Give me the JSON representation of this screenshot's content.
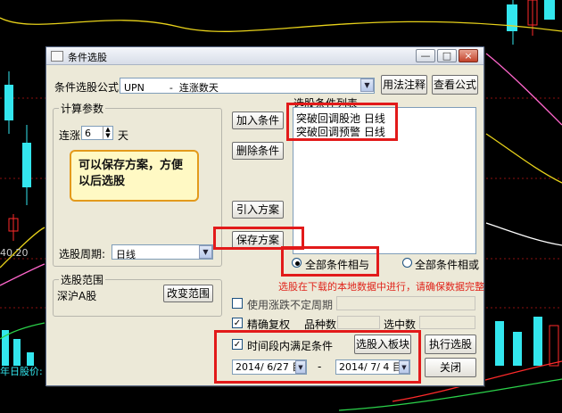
{
  "background": {
    "left_price": "40.20",
    "bottom_text": "年日股价:"
  },
  "dialog": {
    "title": "条件选股",
    "window_buttons": {
      "minimize": "—",
      "maximize": "□",
      "close": "×"
    },
    "formula_label": "条件选股公式",
    "formula_value": "UPN        -  连涨数天",
    "usage_button": "用法注释",
    "view_formula_button": "查看公式",
    "params_group": "计算参数",
    "param_label": "连涨",
    "param_value": "6",
    "param_unit": "天",
    "period_label": "选股周期:",
    "period_value": "日线",
    "scope_group": "选股范围",
    "scope_value": "深沪A股",
    "change_scope_button": "改变范围",
    "add_condition_button": "加入条件",
    "delete_condition_button": "删除条件",
    "import_plan_button": "引入方案",
    "save_plan_button": "保存方案",
    "condition_list_label": "选股条件列表",
    "conditions": [
      "突破回调股池  日线",
      "突破回调预警  日线"
    ],
    "radio_and": "全部条件相与",
    "radio_or": "全部条件相或",
    "warning": "选股在下载的本地数据中进行，请确保数据完整",
    "use_irregular_period": "使用涨跌不定周期",
    "exact_rights": "精确复权",
    "stock_count_label": "品种数",
    "selected_count_label": "选中数",
    "time_range_label": "时间段内满足条件",
    "select_to_block_button": "选股入板块",
    "execute_button": "执行选股",
    "close_button": "关闭",
    "start_date": "2014/ 6/27 目",
    "end_date": "2014/ 7/ 4 目",
    "date_separator": "-"
  },
  "annotation": {
    "callout_text": "可以保存方案，方便以后选股"
  },
  "colors": {
    "highlight_red": "#e21a1a",
    "callout_border": "#e39a1c",
    "callout_fill": "#fff9c4",
    "warning_text": "#e0241b",
    "chart_bg": "#000000",
    "candle_cyan": "#33e6ee",
    "candle_red": "#ff2a2a"
  }
}
